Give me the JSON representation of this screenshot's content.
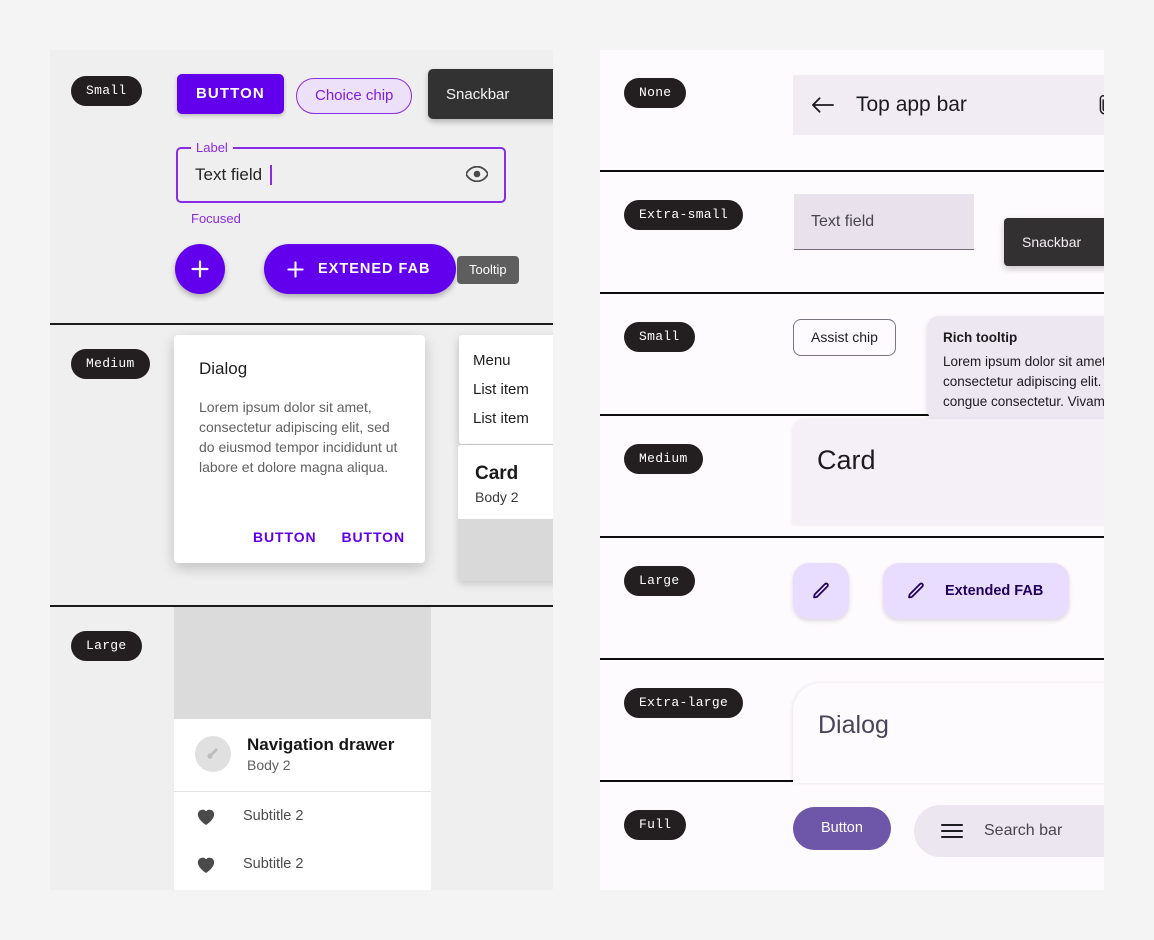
{
  "left_panel": {
    "rows": [
      {
        "badge": "Small",
        "button_label": "BUTTON",
        "chip_label": "Choice chip",
        "snackbar_label": "Snackbar",
        "textfield": {
          "label": "Label",
          "value": "Text field",
          "helper": "Focused",
          "trailing_icon": "eye-icon"
        },
        "fab_icon": "plus-icon",
        "extended_fab_label": "EXTENED FAB",
        "tooltip_label": "Tooltip"
      },
      {
        "badge": "Medium",
        "dialog": {
          "title": "Dialog",
          "body": "Lorem ipsum dolor sit amet, consectetur adipiscing elit, sed do eiusmod tempor incididunt ut labore et dolore magna aliqua.",
          "action_1": "BUTTON",
          "action_2": "BUTTON"
        },
        "menu": {
          "header": "Menu",
          "items": [
            "List item",
            "List item"
          ]
        },
        "card": {
          "title": "Card",
          "subtitle": "Body 2"
        }
      },
      {
        "badge": "Large",
        "nav_drawer": {
          "title": "Navigation drawer",
          "subtitle": "Body 2",
          "items": [
            {
              "icon": "heart-icon",
              "label": "Subtitle 2"
            },
            {
              "icon": "heart-icon",
              "label": "Subtitle 2"
            }
          ]
        }
      }
    ]
  },
  "right_panel": {
    "rows": [
      {
        "badge": "None",
        "app_bar": {
          "back_icon": "arrow-back-icon",
          "title": "Top app bar",
          "action_icon": "attachment-icon"
        }
      },
      {
        "badge": "Extra-small",
        "textfield_placeholder": "Text field",
        "snackbar_label": "Snackbar"
      },
      {
        "badge": "Small",
        "assist_chip_label": "Assist chip",
        "rich_tooltip": {
          "title": "Rich tooltip",
          "body": "Lorem ipsum dolor sit amet, consectetur adipiscing elit. Nullam et congue consectetur. Vivamus"
        }
      },
      {
        "badge": "Medium",
        "card_title": "Card"
      },
      {
        "badge": "Large",
        "fab_icon": "pencil-icon",
        "extended_fab_label": "Extended FAB"
      },
      {
        "badge": "Extra-large",
        "dialog_title": "Dialog"
      },
      {
        "badge": "Full",
        "button_label": "Button",
        "search_bar": {
          "menu_icon": "hamburger-menu-icon",
          "placeholder": "Search bar"
        }
      }
    ]
  },
  "colors": {
    "primary_purple": "#6200EE",
    "chip_purple": "#8A2BE8",
    "fab_container": "#E9DDFF",
    "fab_on_container": "#21005D",
    "snackbar_dark": "#323232",
    "badge_dark": "#231F20",
    "left_surface": "#EFEFEF",
    "right_surface": "#FEFBFF",
    "page_background": "#F4F4F4",
    "full_button": "#6E56A8"
  }
}
